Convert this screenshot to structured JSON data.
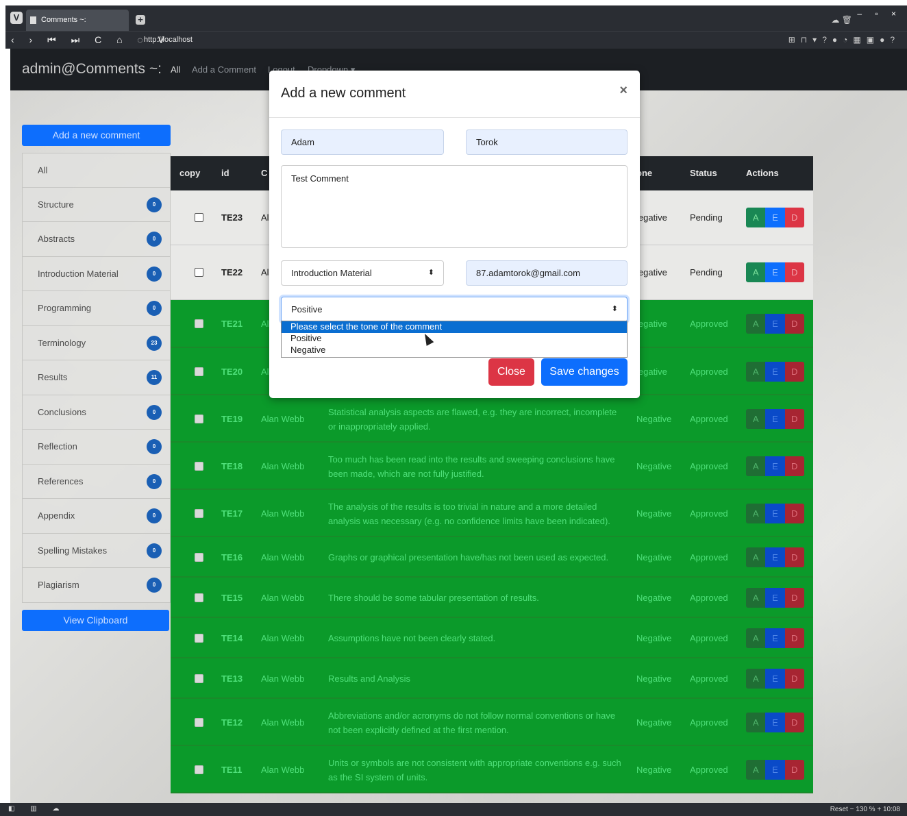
{
  "browser": {
    "tab_title": "Comments ~:",
    "url": "http://localhost",
    "status_right": "Reset  −  130 %  +  10:08"
  },
  "app": {
    "brand": "admin@Comments ~:",
    "nav": {
      "all": "All",
      "add": "Add a Comment",
      "logout": "Logout",
      "dropdown": "Dropdown ▾"
    }
  },
  "sidebar": {
    "add_button": "Add a new comment",
    "items": [
      {
        "label": "All",
        "count": ""
      },
      {
        "label": "Structure",
        "count": "0"
      },
      {
        "label": "Abstracts",
        "count": "0"
      },
      {
        "label": "Introduction Material",
        "count": "0"
      },
      {
        "label": "Programming",
        "count": "0"
      },
      {
        "label": "Terminology",
        "count": "23"
      },
      {
        "label": "Results",
        "count": "11"
      },
      {
        "label": "Conclusions",
        "count": "0"
      },
      {
        "label": "Reflection",
        "count": "0"
      },
      {
        "label": "References",
        "count": "0"
      },
      {
        "label": "Appendix",
        "count": "0"
      },
      {
        "label": "Spelling Mistakes",
        "count": "0"
      },
      {
        "label": "Plagiarism",
        "count": "0"
      }
    ],
    "clipboard_button": "View Clipboard"
  },
  "table": {
    "headers": {
      "copy": "copy",
      "id": "id",
      "commenter": "C",
      "tone": "one",
      "status": "Status",
      "actions": "Actions"
    },
    "action_labels": {
      "approve": "A",
      "edit": "E",
      "delete": "D"
    },
    "rows": [
      {
        "id": "TE23",
        "commenter": "Al",
        "text": "",
        "tone": "legative",
        "status": "Pending",
        "state": "pending"
      },
      {
        "id": "TE22",
        "commenter": "Al",
        "text": "",
        "tone": "legative",
        "status": "Pending",
        "state": "pending"
      },
      {
        "id": "TE21",
        "commenter": "Al",
        "text": "",
        "tone": "legative",
        "status": "Approved",
        "state": "approved"
      },
      {
        "id": "TE20",
        "commenter": "Al",
        "text": "",
        "tone": "legative",
        "status": "Approved",
        "state": "approved"
      },
      {
        "id": "TE19",
        "commenter": "Alan Webb",
        "text": "Statistical analysis aspects are flawed, e.g. they are incorrect, incomplete or inappropriately applied.",
        "tone": "Negative",
        "status": "Approved",
        "state": "approved"
      },
      {
        "id": "TE18",
        "commenter": "Alan Webb",
        "text": "Too much has been read into the results and sweeping conclusions have been made, which are not fully justified.",
        "tone": "Negative",
        "status": "Approved",
        "state": "approved"
      },
      {
        "id": "TE17",
        "commenter": "Alan Webb",
        "text": "The analysis of the results is too trivial in nature and a more detailed analysis was necessary (e.g. no confidence limits have been indicated).",
        "tone": "Negative",
        "status": "Approved",
        "state": "approved"
      },
      {
        "id": "TE16",
        "commenter": "Alan Webb",
        "text": "Graphs or graphical presentation have/has not been used as expected.",
        "tone": "Negative",
        "status": "Approved",
        "state": "approved"
      },
      {
        "id": "TE15",
        "commenter": "Alan Webb",
        "text": "There should be some tabular presentation of results.",
        "tone": "Negative",
        "status": "Approved",
        "state": "approved"
      },
      {
        "id": "TE14",
        "commenter": "Alan Webb",
        "text": "Assumptions have not been clearly stated.",
        "tone": "Negative",
        "status": "Approved",
        "state": "approved"
      },
      {
        "id": "TE13",
        "commenter": "Alan Webb",
        "text": "Results and Analysis",
        "tone": "Negative",
        "status": "Approved",
        "state": "approved"
      },
      {
        "id": "TE12",
        "commenter": "Alan Webb",
        "text": "Abbreviations and/or acronyms do not follow normal conventions or have not been explicitly defined at the first mention.",
        "tone": "Negative",
        "status": "Approved",
        "state": "approved"
      },
      {
        "id": "TE11",
        "commenter": "Alan Webb",
        "text": "Units or symbols are not consistent with appropriate conventions e.g. such as the SI system of units.",
        "tone": "Negative",
        "status": "Approved",
        "state": "approved"
      }
    ]
  },
  "modal": {
    "title": "Add a new comment",
    "close_x": "×",
    "first_name": "Adam",
    "last_name": "Torok",
    "comment": "Test Comment",
    "category": "Introduction Material",
    "email": "87.adamtorok@gmail.com",
    "tone_selected": "Positive",
    "tone_options": [
      "Please select the tone of the comment",
      "Positive",
      "Negative"
    ],
    "close_button": "Close",
    "save_button": "Save changes"
  },
  "colors": {
    "primary": "#0d6efd",
    "danger": "#dc3545",
    "approved_row": "#0b9a2a",
    "navbar": "#1c1f23"
  }
}
